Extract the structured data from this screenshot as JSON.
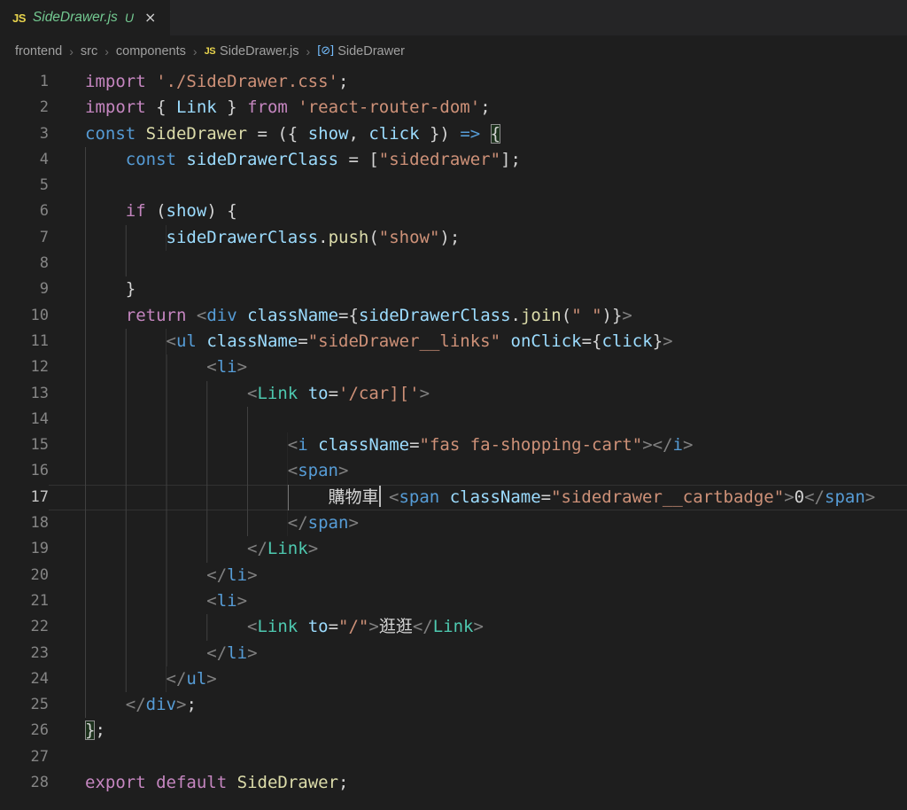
{
  "colors": {
    "editor_bg": "#1e1e1e",
    "tabbar_bg": "#252526",
    "git_untracked_green": "#73c991",
    "js_icon_yellow": "#e8d44d",
    "keyword_pink": "#C586C0",
    "storage_blue": "#569CD6",
    "string_orange": "#CE9178",
    "function_khaki": "#DCDCAA",
    "variable_lightblue": "#9CDCFE",
    "component_teal": "#4EC9B0",
    "jsx_bracket_gray": "#808080",
    "symbol_icon_blue": "#75beff"
  },
  "tab": {
    "icon": "JS",
    "file_name": "SideDrawer.js",
    "git_status": "U",
    "close": "×"
  },
  "breadcrumb": {
    "separator": "›",
    "items": [
      "frontend",
      "src",
      "components"
    ],
    "file_icon": "JS",
    "file": "SideDrawer.js",
    "symbol_icon": "[⊘]",
    "symbol": "SideDrawer"
  },
  "editor": {
    "current_line": 17,
    "lines": [
      {
        "n": 1,
        "tokens": [
          [
            "kw",
            "import"
          ],
          [
            "pn",
            " "
          ],
          [
            "str",
            "'./SideDrawer.css'"
          ],
          [
            "pn",
            ";"
          ]
        ]
      },
      {
        "n": 2,
        "tokens": [
          [
            "kw",
            "import"
          ],
          [
            "pn",
            " { "
          ],
          [
            "vr",
            "Link"
          ],
          [
            "pn",
            " } "
          ],
          [
            "kw",
            "from"
          ],
          [
            "pn",
            " "
          ],
          [
            "str",
            "'react-router-dom'"
          ],
          [
            "pn",
            ";"
          ]
        ]
      },
      {
        "n": 3,
        "tokens": [
          [
            "st",
            "const"
          ],
          [
            "pn",
            " "
          ],
          [
            "fn",
            "SideDrawer"
          ],
          [
            "pn",
            " = ({ "
          ],
          [
            "vr",
            "show"
          ],
          [
            "pn",
            ", "
          ],
          [
            "vr",
            "click"
          ],
          [
            "pn",
            " }) "
          ],
          [
            "st",
            "=>"
          ],
          [
            "pn",
            " "
          ],
          [
            "bm",
            "{"
          ]
        ]
      },
      {
        "n": 4,
        "tokens": [
          [
            "ind",
            "    "
          ],
          [
            "st",
            "const"
          ],
          [
            "pn",
            " "
          ],
          [
            "vr",
            "sideDrawerClass"
          ],
          [
            "pn",
            " = ["
          ],
          [
            "str",
            "\"sidedrawer\""
          ],
          [
            "pn",
            "];"
          ]
        ]
      },
      {
        "n": 5,
        "tokens": [
          [
            "ind",
            "   "
          ]
        ]
      },
      {
        "n": 6,
        "tokens": [
          [
            "ind",
            "    "
          ],
          [
            "kw",
            "if"
          ],
          [
            "pn",
            " ("
          ],
          [
            "vr",
            "show"
          ],
          [
            "pn",
            ") {"
          ]
        ]
      },
      {
        "n": 7,
        "tokens": [
          [
            "ind",
            "        "
          ],
          [
            "vr",
            "sideDrawerClass"
          ],
          [
            "pn",
            "."
          ],
          [
            "fn",
            "push"
          ],
          [
            "pn",
            "("
          ],
          [
            "str",
            "\"show\""
          ],
          [
            "pn",
            ");"
          ]
        ]
      },
      {
        "n": 8,
        "tokens": [
          [
            "ind",
            "       "
          ]
        ]
      },
      {
        "n": 9,
        "tokens": [
          [
            "ind",
            "    "
          ],
          [
            "pn",
            "}"
          ]
        ]
      },
      {
        "n": 10,
        "tokens": [
          [
            "ind",
            "    "
          ],
          [
            "kw",
            "return"
          ],
          [
            "pn",
            " "
          ],
          [
            "ab",
            "<"
          ],
          [
            "tag",
            "div"
          ],
          [
            "pn",
            " "
          ],
          [
            "vr",
            "className"
          ],
          [
            "pn",
            "={"
          ],
          [
            "vr",
            "sideDrawerClass"
          ],
          [
            "pn",
            "."
          ],
          [
            "fn",
            "join"
          ],
          [
            "pn",
            "("
          ],
          [
            "str",
            "\" \""
          ],
          [
            "pn",
            ")}"
          ],
          [
            "ab",
            ">"
          ]
        ]
      },
      {
        "n": 11,
        "tokens": [
          [
            "ind",
            "        "
          ],
          [
            "ab",
            "<"
          ],
          [
            "tag",
            "ul"
          ],
          [
            "pn",
            " "
          ],
          [
            "vr",
            "className"
          ],
          [
            "pn",
            "="
          ],
          [
            "str",
            "\"sideDrawer__links\""
          ],
          [
            "pn",
            " "
          ],
          [
            "vr",
            "onClick"
          ],
          [
            "pn",
            "={"
          ],
          [
            "vr",
            "click"
          ],
          [
            "pn",
            "}"
          ],
          [
            "ab",
            ">"
          ]
        ]
      },
      {
        "n": 12,
        "tokens": [
          [
            "ind",
            "            "
          ],
          [
            "ab",
            "<"
          ],
          [
            "tag",
            "li"
          ],
          [
            "ab",
            ">"
          ]
        ]
      },
      {
        "n": 13,
        "tokens": [
          [
            "ind",
            "                "
          ],
          [
            "ab",
            "<"
          ],
          [
            "cmp",
            "Link"
          ],
          [
            "pn",
            " "
          ],
          [
            "vr",
            "to"
          ],
          [
            "pn",
            "="
          ],
          [
            "str",
            "'/car]['"
          ],
          [
            "ab",
            ">"
          ]
        ]
      },
      {
        "n": 14,
        "tokens": [
          [
            "ind",
            "                   "
          ]
        ]
      },
      {
        "n": 15,
        "tokens": [
          [
            "ind",
            "                    "
          ],
          [
            "ab",
            "<"
          ],
          [
            "tag",
            "i"
          ],
          [
            "pn",
            " "
          ],
          [
            "vr",
            "className"
          ],
          [
            "pn",
            "="
          ],
          [
            "str",
            "\"fas fa-shopping-cart\""
          ],
          [
            "ab",
            "></"
          ],
          [
            "tag",
            "i"
          ],
          [
            "ab",
            ">"
          ]
        ]
      },
      {
        "n": 16,
        "tokens": [
          [
            "ind",
            "                    "
          ],
          [
            "ab",
            "<"
          ],
          [
            "tag",
            "span"
          ],
          [
            "ab",
            ">"
          ]
        ]
      },
      {
        "n": 17,
        "tokens": [
          [
            "ind",
            "                    "
          ],
          [
            "inda",
            "    "
          ],
          [
            "tx",
            "購物車"
          ],
          [
            "cursor",
            ""
          ],
          [
            "tx",
            " "
          ],
          [
            "ab",
            "<"
          ],
          [
            "tag",
            "span"
          ],
          [
            "pn",
            " "
          ],
          [
            "vr",
            "className"
          ],
          [
            "pn",
            "="
          ],
          [
            "str",
            "\"sidedrawer__cartbadge\""
          ],
          [
            "ab",
            ">"
          ],
          [
            "tx",
            "0"
          ],
          [
            "ab",
            "</"
          ],
          [
            "tag",
            "span"
          ],
          [
            "ab",
            ">"
          ]
        ]
      },
      {
        "n": 18,
        "tokens": [
          [
            "ind",
            "                    "
          ],
          [
            "ab",
            "</"
          ],
          [
            "tag",
            "span"
          ],
          [
            "ab",
            ">"
          ]
        ]
      },
      {
        "n": 19,
        "tokens": [
          [
            "ind",
            "                "
          ],
          [
            "ab",
            "</"
          ],
          [
            "cmp",
            "Link"
          ],
          [
            "ab",
            ">"
          ]
        ]
      },
      {
        "n": 20,
        "tokens": [
          [
            "ind",
            "            "
          ],
          [
            "ab",
            "</"
          ],
          [
            "tag",
            "li"
          ],
          [
            "ab",
            ">"
          ]
        ]
      },
      {
        "n": 21,
        "tokens": [
          [
            "ind",
            "            "
          ],
          [
            "ab",
            "<"
          ],
          [
            "tag",
            "li"
          ],
          [
            "ab",
            ">"
          ]
        ]
      },
      {
        "n": 22,
        "tokens": [
          [
            "ind",
            "                "
          ],
          [
            "ab",
            "<"
          ],
          [
            "cmp",
            "Link"
          ],
          [
            "pn",
            " "
          ],
          [
            "vr",
            "to"
          ],
          [
            "pn",
            "="
          ],
          [
            "str",
            "\"/\""
          ],
          [
            "ab",
            ">"
          ],
          [
            "tx",
            "逛逛"
          ],
          [
            "ab",
            "</"
          ],
          [
            "cmp",
            "Link"
          ],
          [
            "ab",
            ">"
          ]
        ]
      },
      {
        "n": 23,
        "tokens": [
          [
            "ind",
            "            "
          ],
          [
            "ab",
            "</"
          ],
          [
            "tag",
            "li"
          ],
          [
            "ab",
            ">"
          ]
        ]
      },
      {
        "n": 24,
        "tokens": [
          [
            "ind",
            "        "
          ],
          [
            "ab",
            "</"
          ],
          [
            "tag",
            "ul"
          ],
          [
            "ab",
            ">"
          ]
        ]
      },
      {
        "n": 25,
        "tokens": [
          [
            "ind",
            "    "
          ],
          [
            "ab",
            "</"
          ],
          [
            "tag",
            "div"
          ],
          [
            "ab",
            ">"
          ],
          [
            "pn",
            ";"
          ]
        ]
      },
      {
        "n": 26,
        "tokens": [
          [
            "bm",
            "}"
          ],
          [
            "pn",
            ";"
          ]
        ]
      },
      {
        "n": 27,
        "tokens": []
      },
      {
        "n": 28,
        "tokens": [
          [
            "kw",
            "export"
          ],
          [
            "pn",
            " "
          ],
          [
            "kw",
            "default"
          ],
          [
            "pn",
            " "
          ],
          [
            "fn",
            "SideDrawer"
          ],
          [
            "pn",
            ";"
          ]
        ]
      }
    ]
  }
}
